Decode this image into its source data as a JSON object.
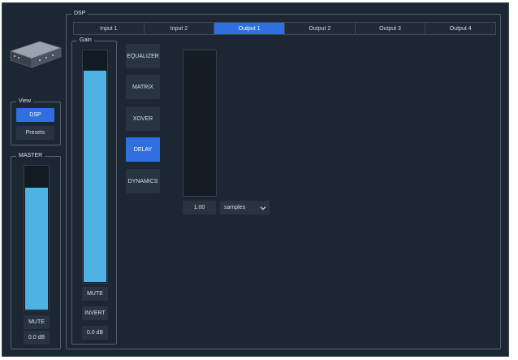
{
  "view": {
    "title": "View",
    "buttons": [
      {
        "label": "DSP",
        "active": true
      },
      {
        "label": "Presets",
        "active": false
      }
    ]
  },
  "master": {
    "title": "MASTER",
    "level": 0.84,
    "mute_label": "MUTE",
    "value": "0.0 dB"
  },
  "dsp": {
    "title": "DSP",
    "tabs": [
      {
        "label": "Input 1",
        "active": false
      },
      {
        "label": "Input 2",
        "active": false
      },
      {
        "label": "Output 1",
        "active": true
      },
      {
        "label": "Output 2",
        "active": false
      },
      {
        "label": "Output 3",
        "active": false
      },
      {
        "label": "Output 4",
        "active": false
      }
    ]
  },
  "gain": {
    "title": "Gain",
    "level": 0.91,
    "mute_label": "MUTE",
    "invert_label": "INVERT",
    "value": "0.0 dB"
  },
  "modules": [
    {
      "label": "EQUALIZER",
      "active": false
    },
    {
      "label": "MATRIX",
      "active": false
    },
    {
      "label": "XOVER",
      "active": false
    },
    {
      "label": "DELAY",
      "active": true
    },
    {
      "label": "DYNAMICS",
      "active": false
    }
  ],
  "delay": {
    "value": "1.00",
    "unit": "samples"
  },
  "colors": {
    "accent": "#2f6fe0",
    "meter": "#4fb2e5",
    "background": "#1c2733"
  }
}
